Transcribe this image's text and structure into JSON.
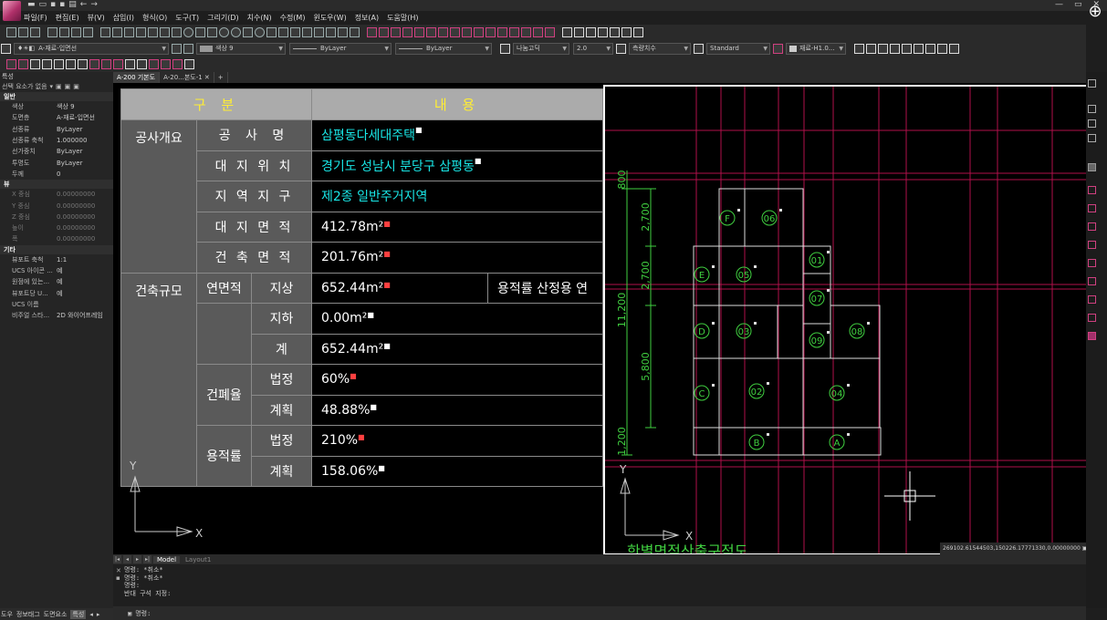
{
  "menu": [
    "파일(F)",
    "편집(E)",
    "뷰(V)",
    "삽입(I)",
    "형식(O)",
    "도구(T)",
    "그리기(D)",
    "치수(N)",
    "수정(M)",
    "윈도우(W)",
    "정보(A)",
    "도움말(H)"
  ],
  "toolbar": {
    "layer": "A-재료-입면선",
    "color": "색상 9",
    "linetype": "ByLayer",
    "lineweight": "ByLayer",
    "text_style": "나눔고딕",
    "text_height": "2.0",
    "dim_style": "측량치수",
    "table_style": "Standard",
    "current_layer": "재료-H1.0..."
  },
  "properties": {
    "title": "특성",
    "selection": "선택 요소가 없음",
    "sections": {
      "general": "일반",
      "view": "뷰",
      "misc": "기타"
    },
    "general_rows": [
      {
        "k": "색상",
        "v": "색상 9"
      },
      {
        "k": "도면층",
        "v": "A-재료-입면선"
      },
      {
        "k": "선종류",
        "v": "ByLayer"
      },
      {
        "k": "선종류 축척",
        "v": "1.000000"
      },
      {
        "k": "선가중치",
        "v": "ByLayer"
      },
      {
        "k": "투명도",
        "v": "ByLayer"
      },
      {
        "k": "두께",
        "v": "0"
      }
    ],
    "view_rows": [
      {
        "k": "X 중심",
        "v": "0.00000000"
      },
      {
        "k": "Y 중심",
        "v": "0.00000000"
      },
      {
        "k": "Z 중심",
        "v": "0.00000000"
      },
      {
        "k": "높이",
        "v": "0.00000000"
      },
      {
        "k": "폭",
        "v": "0.00000000"
      }
    ],
    "misc_rows": [
      {
        "k": "뷰포트 축척",
        "v": "1:1"
      },
      {
        "k": "UCS 아이콘 ...",
        "v": "예"
      },
      {
        "k": "원점에 있는...",
        "v": "예"
      },
      {
        "k": "뷰포트당 U...",
        "v": "예"
      },
      {
        "k": "UCS 이름",
        "v": ""
      },
      {
        "k": "비주얼 스타...",
        "v": "2D 와이어프레임"
      }
    ]
  },
  "doc_tabs": [
    "A-200 기본도",
    "A-20...본도-1",
    "+"
  ],
  "palette_tabs": [
    "도우",
    "정보태그",
    "도면요소",
    "특성"
  ],
  "table": {
    "head_category": "구 분",
    "head_content": "내 용",
    "overview_label": "공사개요",
    "scale_label": "건축규모",
    "rows": {
      "name_label": "공 사 명",
      "name_value": "삼평동다세대주택",
      "site_label": "대 지 위 치",
      "site_value": "경기도 성남시 분당구 삼평동",
      "zone_label": "지 역 지 구",
      "zone_value": "제2종 일반주거지역",
      "site_area_label": "대 지 면 적",
      "site_area_value": "412.78m²",
      "building_area_label": "건 축 면 적",
      "building_area_value": "201.76m²",
      "floor_area_label": "연면적",
      "above_label": "지상",
      "above_value": "652.44m²",
      "far_note": "용적률 산정용 연",
      "below_label": "지하",
      "below_value": "0.00m²",
      "total_label": "계",
      "total_value": "652.44m²",
      "bcr_label": "건폐율",
      "bcr_legal_label": "법정",
      "bcr_legal_value": "60%",
      "bcr_plan_label": "계획",
      "bcr_plan_value": "48.88%",
      "far_label": "용적률",
      "far_legal_label": "법정",
      "far_legal_value": "210%",
      "far_plan_label": "계획",
      "far_plan_value": "158.06%"
    }
  },
  "plan": {
    "dims": [
      "800",
      "2,700",
      "2,700",
      "11,200",
      "5,800",
      "1,200"
    ],
    "room_tags": [
      "F",
      "06",
      "E",
      "05",
      "01",
      "07",
      "D",
      "03",
      "09",
      "08",
      "C",
      "02",
      "04",
      "B",
      "A"
    ],
    "bottom_title": "한별면적산출구적도"
  },
  "ucs": {
    "x": "X",
    "y": "Y"
  },
  "coords": "269102.61544503,150226.17771330,0.00000000",
  "layout_tabs": [
    "Model",
    "Layout1"
  ],
  "command_history": [
    "명령: *취소*",
    "명령: *취소*",
    "명령:",
    "반대 구석 지정:"
  ],
  "command_prompt": "명령:",
  "colors": {
    "cyan_text": "#19e6e6",
    "yellow_head": "#ffee33",
    "green_plan": "#40d040",
    "red_grid": "#c0104a"
  }
}
